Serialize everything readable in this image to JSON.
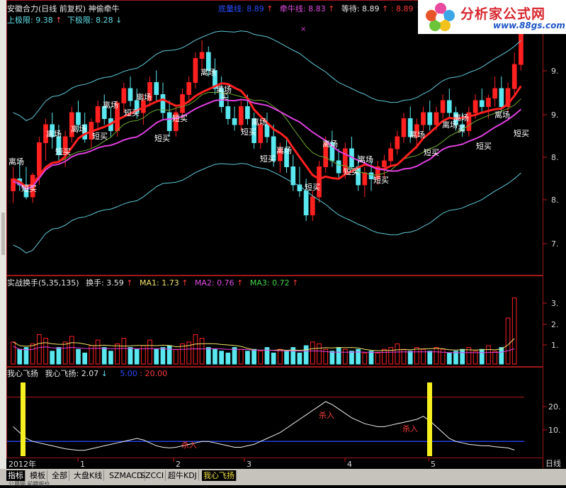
{
  "header": {
    "title": "安徽合力(日线 前复权)",
    "formula": "神偷牵牛",
    "niuxian_label": "底量线: 8.89",
    "qianniu_label": "牵牛线: 8.83",
    "dengdai_label": "等待: 8.89",
    "dengdai_val2": ": 8.89",
    "upper_label": "上极限: 9.38",
    "lower_label": "下极限: 8.28"
  },
  "logo": {
    "brand": "分析家公式网",
    "url": "www.88gs.com"
  },
  "panel2": {
    "title": "实战换手(5,35,135)",
    "huanshou": "换手: 3.59",
    "ma1": "MA1: 1.73",
    "ma2": "MA2: 0.76",
    "ma3": "MA3: 0.72"
  },
  "panel3": {
    "title": "我心飞扬",
    "value": "我心飞扬: 2.07",
    "v1": "5.00",
    "v2": ": 20.00"
  },
  "price_axis": [
    "9.",
    "9.",
    "8.",
    "8.",
    "7."
  ],
  "vol_axis": [
    "3.",
    "2.",
    "1."
  ],
  "ind_axis": [
    "20.",
    "10."
  ],
  "x_axis": {
    "start": "2012年",
    "labels": [
      "1",
      "2",
      "3",
      "4",
      "5"
    ],
    "right": "日线"
  },
  "annotations": {
    "likai": "离场",
    "duanmai": "短买",
    "mai": "买",
    "sharu": "杀入"
  },
  "tabs": [
    "指标",
    "模板",
    "全部",
    "大盘K线",
    "SZMACD",
    "SZCCI",
    "超牛KDJ",
    "我心飞扬"
  ],
  "bottom_text": "公用网 前期报价",
  "colors": {
    "up": "#ff2020",
    "down": "#5ae8f0",
    "ma_red": "#ff2020",
    "ma_magenta": "#e040e0",
    "band": "#5fc8d8",
    "highlight": "#f6f020"
  },
  "chart_data": {
    "type": "candlestick",
    "ylim": [
      7.7,
      9.7
    ],
    "candles": [
      {
        "o": 8.35,
        "h": 8.55,
        "l": 8.25,
        "c": 8.45
      },
      {
        "o": 8.45,
        "h": 8.6,
        "l": 8.35,
        "c": 8.4
      },
      {
        "o": 8.4,
        "h": 8.55,
        "l": 8.28,
        "c": 8.3
      },
      {
        "o": 8.3,
        "h": 8.5,
        "l": 8.25,
        "c": 8.48
      },
      {
        "o": 8.48,
        "h": 8.8,
        "l": 8.4,
        "c": 8.75
      },
      {
        "o": 8.75,
        "h": 8.95,
        "l": 8.6,
        "c": 8.9
      },
      {
        "o": 8.9,
        "h": 9.0,
        "l": 8.7,
        "c": 8.8
      },
      {
        "o": 8.8,
        "h": 8.9,
        "l": 8.6,
        "c": 8.65
      },
      {
        "o": 8.65,
        "h": 8.85,
        "l": 8.55,
        "c": 8.8
      },
      {
        "o": 8.8,
        "h": 9.05,
        "l": 8.75,
        "c": 9.0
      },
      {
        "o": 9.0,
        "h": 9.1,
        "l": 8.85,
        "c": 8.9
      },
      {
        "o": 8.9,
        "h": 9.0,
        "l": 8.75,
        "c": 8.78
      },
      {
        "o": 8.78,
        "h": 8.95,
        "l": 8.7,
        "c": 8.92
      },
      {
        "o": 8.92,
        "h": 9.1,
        "l": 8.85,
        "c": 9.05
      },
      {
        "o": 9.05,
        "h": 9.15,
        "l": 8.9,
        "c": 8.95
      },
      {
        "o": 8.95,
        "h": 9.05,
        "l": 8.8,
        "c": 8.85
      },
      {
        "o": 8.85,
        "h": 9.1,
        "l": 8.8,
        "c": 9.08
      },
      {
        "o": 9.08,
        "h": 9.25,
        "l": 9.0,
        "c": 9.2
      },
      {
        "o": 9.2,
        "h": 9.3,
        "l": 9.05,
        "c": 9.1
      },
      {
        "o": 9.1,
        "h": 9.2,
        "l": 8.95,
        "c": 9.0
      },
      {
        "o": 9.0,
        "h": 9.15,
        "l": 8.9,
        "c": 9.1
      },
      {
        "o": 9.1,
        "h": 9.3,
        "l": 9.05,
        "c": 9.25
      },
      {
        "o": 9.25,
        "h": 9.35,
        "l": 9.1,
        "c": 9.15
      },
      {
        "o": 9.15,
        "h": 9.25,
        "l": 8.95,
        "c": 9.0
      },
      {
        "o": 9.0,
        "h": 9.1,
        "l": 8.8,
        "c": 8.85
      },
      {
        "o": 8.85,
        "h": 9.05,
        "l": 8.8,
        "c": 9.0
      },
      {
        "o": 9.0,
        "h": 9.2,
        "l": 8.95,
        "c": 9.15
      },
      {
        "o": 9.15,
        "h": 9.3,
        "l": 9.1,
        "c": 9.25
      },
      {
        "o": 9.25,
        "h": 9.5,
        "l": 9.2,
        "c": 9.45
      },
      {
        "o": 9.45,
        "h": 9.6,
        "l": 9.35,
        "c": 9.5
      },
      {
        "o": 9.5,
        "h": 9.55,
        "l": 9.3,
        "c": 9.35
      },
      {
        "o": 9.35,
        "h": 9.45,
        "l": 9.15,
        "c": 9.2
      },
      {
        "o": 9.2,
        "h": 9.3,
        "l": 9.0,
        "c": 9.05
      },
      {
        "o": 9.05,
        "h": 9.15,
        "l": 8.9,
        "c": 8.95
      },
      {
        "o": 8.95,
        "h": 9.05,
        "l": 8.85,
        "c": 8.9
      },
      {
        "o": 8.9,
        "h": 9.1,
        "l": 8.85,
        "c": 9.05
      },
      {
        "o": 9.05,
        "h": 9.15,
        "l": 8.9,
        "c": 8.95
      },
      {
        "o": 8.95,
        "h": 9.0,
        "l": 8.7,
        "c": 8.75
      },
      {
        "o": 8.75,
        "h": 8.95,
        "l": 8.7,
        "c": 8.9
      },
      {
        "o": 8.9,
        "h": 9.0,
        "l": 8.75,
        "c": 8.8
      },
      {
        "o": 8.8,
        "h": 8.9,
        "l": 8.55,
        "c": 8.6
      },
      {
        "o": 8.6,
        "h": 8.75,
        "l": 8.5,
        "c": 8.7
      },
      {
        "o": 8.7,
        "h": 8.8,
        "l": 8.5,
        "c": 8.55
      },
      {
        "o": 8.55,
        "h": 8.65,
        "l": 8.35,
        "c": 8.4
      },
      {
        "o": 8.4,
        "h": 8.55,
        "l": 8.3,
        "c": 8.35
      },
      {
        "o": 8.35,
        "h": 8.45,
        "l": 8.1,
        "c": 8.15
      },
      {
        "o": 8.15,
        "h": 8.35,
        "l": 8.1,
        "c": 8.3
      },
      {
        "o": 8.3,
        "h": 8.6,
        "l": 8.25,
        "c": 8.55
      },
      {
        "o": 8.55,
        "h": 8.8,
        "l": 8.5,
        "c": 8.75
      },
      {
        "o": 8.75,
        "h": 8.85,
        "l": 8.55,
        "c": 8.6
      },
      {
        "o": 8.6,
        "h": 8.7,
        "l": 8.45,
        "c": 8.5
      },
      {
        "o": 8.5,
        "h": 8.75,
        "l": 8.45,
        "c": 8.7
      },
      {
        "o": 8.7,
        "h": 8.8,
        "l": 8.5,
        "c": 8.55
      },
      {
        "o": 8.55,
        "h": 8.65,
        "l": 8.35,
        "c": 8.4
      },
      {
        "o": 8.4,
        "h": 8.55,
        "l": 8.3,
        "c": 8.5
      },
      {
        "o": 8.5,
        "h": 8.6,
        "l": 8.35,
        "c": 8.45
      },
      {
        "o": 8.45,
        "h": 8.6,
        "l": 8.4,
        "c": 8.55
      },
      {
        "o": 8.55,
        "h": 8.65,
        "l": 8.45,
        "c": 8.6
      },
      {
        "o": 8.6,
        "h": 8.75,
        "l": 8.55,
        "c": 8.7
      },
      {
        "o": 8.7,
        "h": 8.85,
        "l": 8.65,
        "c": 8.8
      },
      {
        "o": 8.8,
        "h": 9.0,
        "l": 8.75,
        "c": 8.95
      },
      {
        "o": 8.95,
        "h": 9.05,
        "l": 8.75,
        "c": 8.8
      },
      {
        "o": 8.8,
        "h": 8.95,
        "l": 8.7,
        "c": 8.9
      },
      {
        "o": 8.9,
        "h": 9.05,
        "l": 8.85,
        "c": 9.0
      },
      {
        "o": 9.0,
        "h": 9.1,
        "l": 8.85,
        "c": 8.9
      },
      {
        "o": 8.9,
        "h": 9.05,
        "l": 8.85,
        "c": 9.0
      },
      {
        "o": 9.0,
        "h": 9.15,
        "l": 8.95,
        "c": 9.1
      },
      {
        "o": 9.1,
        "h": 9.2,
        "l": 8.95,
        "c": 9.0
      },
      {
        "o": 9.0,
        "h": 9.05,
        "l": 8.85,
        "c": 8.9
      },
      {
        "o": 8.9,
        "h": 9.0,
        "l": 8.8,
        "c": 8.85
      },
      {
        "o": 8.85,
        "h": 9.05,
        "l": 8.8,
        "c": 9.0
      },
      {
        "o": 9.0,
        "h": 9.15,
        "l": 8.95,
        "c": 9.1
      },
      {
        "o": 9.1,
        "h": 9.2,
        "l": 9.0,
        "c": 9.05
      },
      {
        "o": 9.05,
        "h": 9.15,
        "l": 8.95,
        "c": 9.12
      },
      {
        "o": 9.12,
        "h": 9.3,
        "l": 9.05,
        "c": 9.2
      },
      {
        "o": 9.2,
        "h": 9.3,
        "l": 9.0,
        "c": 9.05
      },
      {
        "o": 9.05,
        "h": 9.25,
        "l": 9.0,
        "c": 9.2
      },
      {
        "o": 9.2,
        "h": 9.5,
        "l": 9.15,
        "c": 9.4
      },
      {
        "o": 9.4,
        "h": 9.7,
        "l": 9.35,
        "c": 9.65
      }
    ],
    "volumes": [
      1.2,
      0.8,
      0.9,
      1.1,
      1.6,
      1.4,
      0.7,
      0.9,
      1.2,
      1.5,
      0.8,
      0.6,
      1.0,
      1.3,
      0.9,
      0.7,
      1.1,
      1.4,
      0.9,
      0.8,
      1.0,
      1.3,
      0.8,
      0.9,
      1.0,
      0.8,
      1.1,
      1.2,
      1.6,
      1.4,
      0.9,
      0.8,
      0.7,
      0.6,
      0.9,
      0.8,
      0.7,
      0.8,
      0.7,
      0.9,
      0.6,
      0.8,
      0.7,
      0.9,
      0.6,
      1.0,
      1.2,
      1.1,
      0.8,
      0.7,
      0.9,
      0.8,
      0.7,
      0.8,
      0.6,
      0.7,
      0.6,
      0.8,
      0.9,
      1.1,
      0.8,
      0.7,
      0.9,
      0.8,
      0.7,
      0.9,
      0.8,
      0.6,
      0.7,
      0.8,
      0.9,
      0.7,
      0.8,
      1.0,
      0.7,
      0.9,
      2.5,
      3.59
    ],
    "indicator": [
      10,
      8,
      6,
      5,
      4.5,
      4,
      3.5,
      3,
      2.5,
      2.2,
      2,
      2,
      2.5,
      3,
      3.5,
      4,
      4.5,
      5,
      5.5,
      6,
      5.5,
      4.5,
      3.5,
      3,
      2.8,
      3,
      3.5,
      4,
      4.5,
      5,
      5,
      4.5,
      4,
      3.5,
      3,
      3,
      3.5,
      4,
      5,
      6,
      7,
      8,
      9.5,
      11,
      12.5,
      14,
      15.5,
      17,
      18.5,
      17.5,
      16,
      14.5,
      13,
      12,
      11,
      10.5,
      10,
      10,
      10.5,
      11,
      11.5,
      12,
      12.5,
      13.5,
      12,
      10,
      8,
      6,
      5,
      4.5,
      4,
      3.8,
      3.5,
      3.5,
      3.2,
      3,
      2.8,
      2.07
    ],
    "indicator_ylim": [
      0,
      25
    ]
  }
}
